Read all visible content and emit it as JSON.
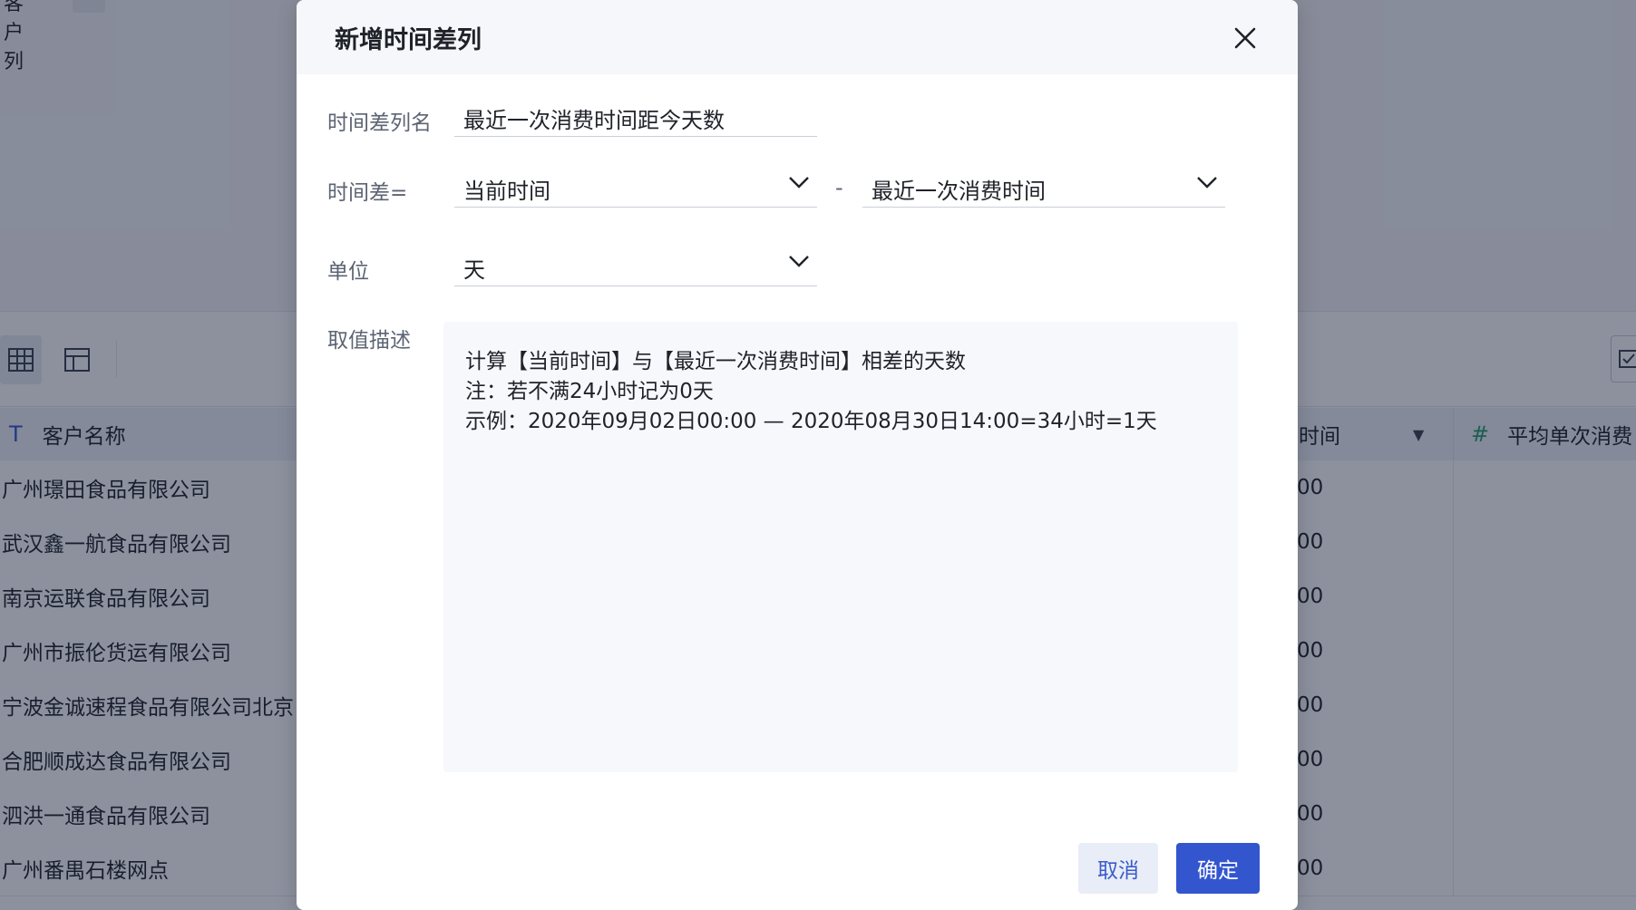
{
  "background": {
    "top_left_fragment": "客户列",
    "columns": [
      {
        "icon": "text-type-icon",
        "label": "客户名称"
      },
      {
        "icon": "",
        "label": "时间"
      },
      {
        "icon": "number-type-icon",
        "label": "平均单次消费"
      }
    ],
    "rows": [
      {
        "name": "广州璟田食品有限公司",
        "time_fragment": "00"
      },
      {
        "name": "武汉鑫一航食品有限公司",
        "time_fragment": "00"
      },
      {
        "name": "南京运联食品有限公司",
        "time_fragment": "00"
      },
      {
        "name": "广州市振伦货运有限公司",
        "time_fragment": "00"
      },
      {
        "name": "宁波金诚速程食品有限公司北京",
        "time_fragment": "00"
      },
      {
        "name": "合肥顺成达食品有限公司",
        "time_fragment": "00"
      },
      {
        "name": "泗洪一通食品有限公司",
        "time_fragment": "00"
      },
      {
        "name": "广州番禺石楼网点",
        "time_fragment": "00"
      }
    ]
  },
  "dialog": {
    "title": "新增时间差列",
    "close_icon": "close-icon",
    "name_label": "时间差列名",
    "name_value": "最近一次消费时间距今天数",
    "diff_label": "时间差=",
    "start_value": "当前时间",
    "minus": "-",
    "end_value": "最近一次消费时间",
    "unit_label": "单位",
    "unit_value": "天",
    "desc_label": "取值描述",
    "desc_lines": [
      "计算【当前时间】与【最近一次消费时间】相差的天数",
      "注：若不满24小时记为0天",
      "示例：2020年09月02日00:00 — 2020年08月30日14:00=34小时=1天"
    ],
    "cancel_label": "取消",
    "ok_label": "确定",
    "accent_color": "#3356cf"
  }
}
